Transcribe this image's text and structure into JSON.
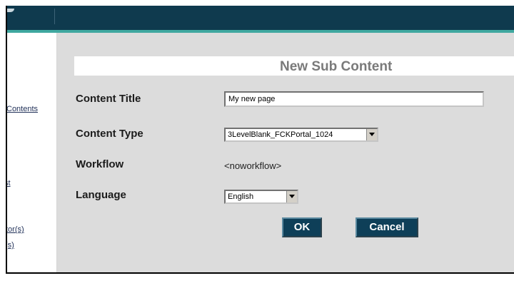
{
  "sidebar": {
    "links": [
      "Contents",
      "st",
      "tor(s)",
      "(s)"
    ]
  },
  "form": {
    "title": "New Sub Content",
    "content_title_label": "Content Title",
    "content_title_value": "My new page",
    "content_type_label": "Content Type",
    "content_type_value": "3LevelBlank_FCKPortal_1024",
    "workflow_label": "Workflow",
    "workflow_value": "<noworkflow>",
    "language_label": "Language",
    "language_value": "English",
    "ok_label": "OK",
    "cancel_label": "Cancel"
  },
  "colors": {
    "topbar": "#0f3a4e",
    "accent": "#3fa8a0",
    "button": "#0e3f58",
    "content_bg": "#dcdcdc"
  },
  "icons": {
    "dropdown": "chevron-down-icon"
  }
}
